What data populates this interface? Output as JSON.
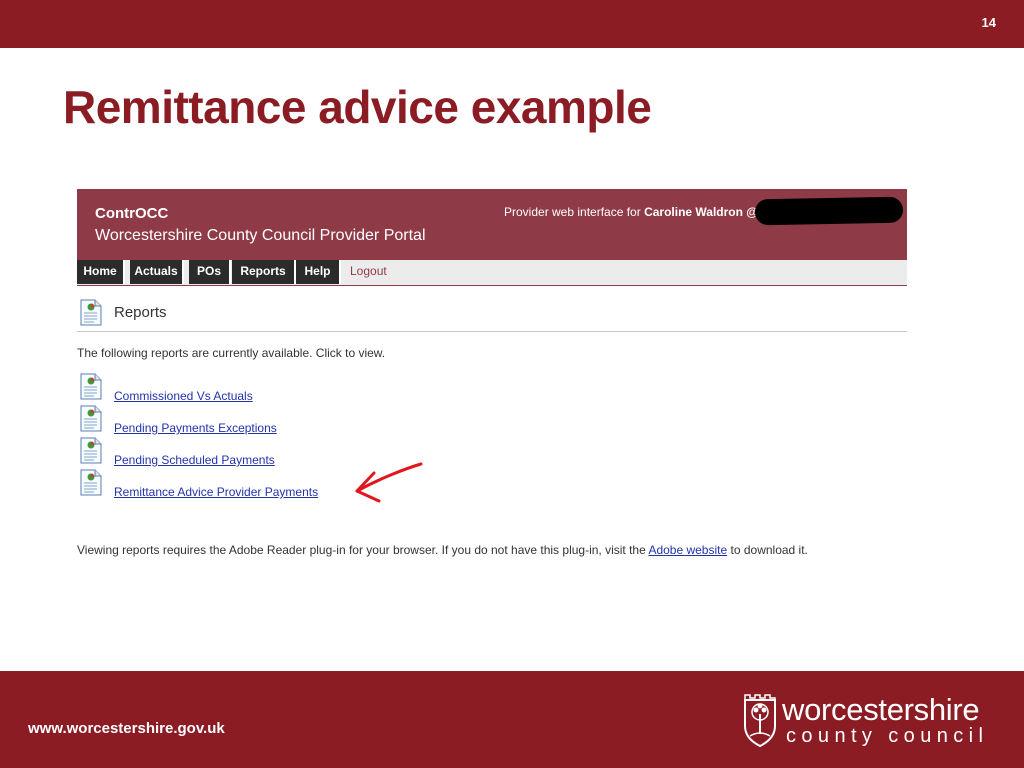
{
  "slide": {
    "number": "14",
    "title": "Remittance advice example",
    "footer_url": "www.worcestershire.gov.uk",
    "logo_line1": "worcestershire",
    "logo_line2": "county council"
  },
  "portal": {
    "brand": "ContrOCC",
    "name": "Worcestershire County Council Provider Portal",
    "user_prefix": "Provider web interface for ",
    "user_name": "Caroline Waldron @",
    "nav": [
      "Home",
      "Actuals",
      "POs",
      "Reports",
      "Help"
    ],
    "logout": "Logout",
    "page_heading": "Reports",
    "intro": "The following reports are currently available. Click to view.",
    "reports": [
      "Commissioned Vs Actuals",
      "Pending Payments Exceptions",
      "Pending Scheduled Payments",
      "Remittance Advice Provider Payments"
    ],
    "footnote_before": "Viewing reports requires the Adobe Reader plug-in for your browser. If you do not have this plug-in, visit the ",
    "footnote_link": "Adobe website",
    "footnote_after": " to download it."
  },
  "colors": {
    "brand_red": "#8b1c24",
    "portal_header": "#8f3a47",
    "link_blue": "#2233aa",
    "arrow_red": "#e0181e"
  },
  "icons": [
    "report-document-icon",
    "arrow-annotation-icon",
    "council-crest-icon"
  ]
}
